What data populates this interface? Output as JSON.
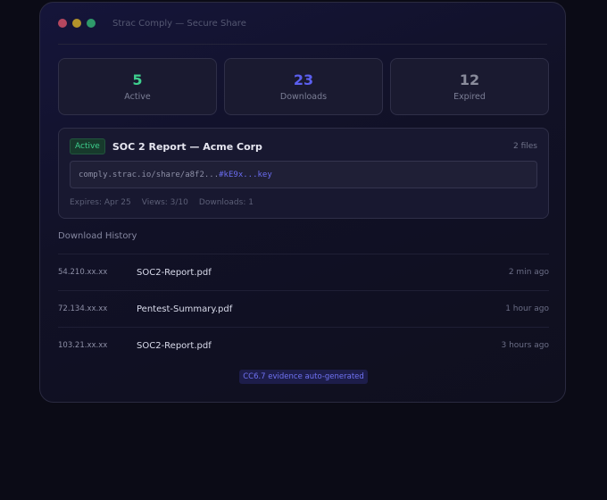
{
  "window": {
    "title": "Strac Comply — Secure Share"
  },
  "colors": {
    "active": "#3ecf8e",
    "downloads": "#5b5ff0",
    "expired": "#8a8c9c"
  },
  "stats": [
    {
      "value": "5",
      "label": "Active"
    },
    {
      "value": "23",
      "label": "Downloads"
    },
    {
      "value": "12",
      "label": "Expired"
    }
  ],
  "share": {
    "status": "Active",
    "title": "SOC 2 Report — Acme Corp",
    "files": "2 files",
    "link_prefix": "comply.strac.io/share/a8f2...",
    "link_key": "#kE9x...key",
    "expires": "Expires: Apr 25",
    "views": "Views: 3/10",
    "downloads": "Downloads: 1"
  },
  "history": {
    "title": "Download History",
    "rows": [
      {
        "ip": "54.210.xx.xx",
        "file": "SOC2-Report.pdf",
        "when": "2 min ago"
      },
      {
        "ip": "72.134.xx.xx",
        "file": "Pentest-Summary.pdf",
        "when": "1 hour ago"
      },
      {
        "ip": "103.21.xx.xx",
        "file": "SOC2-Report.pdf",
        "when": "3 hours ago"
      }
    ]
  },
  "footer": {
    "badge": "CC6.7 evidence auto-generated"
  }
}
